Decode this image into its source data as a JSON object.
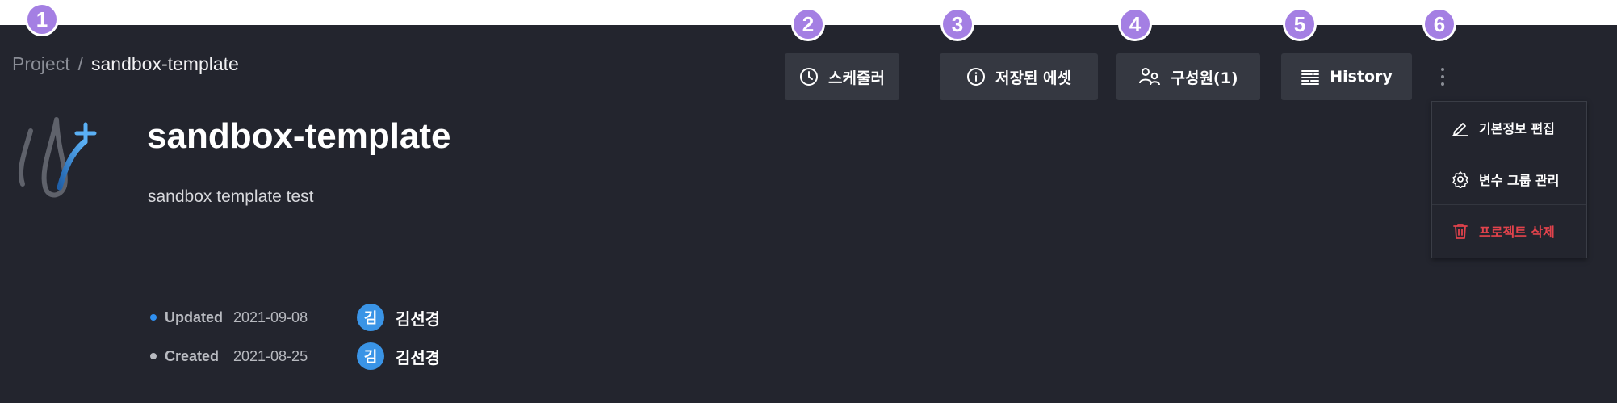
{
  "markers": [
    "1",
    "2",
    "3",
    "4",
    "5",
    "6"
  ],
  "breadcrumb": {
    "project": "Project",
    "separator": "/",
    "current": "sandbox-template"
  },
  "project": {
    "title": "sandbox-template",
    "description": "sandbox template test",
    "logo_icon": "droplet-plus-logo"
  },
  "meta": {
    "updated": {
      "label": "Updated",
      "date": "2021-09-08",
      "avatar": "김",
      "user": "김선경",
      "dot_color": "#2f8ff0"
    },
    "created": {
      "label": "Created",
      "date": "2021-08-25",
      "avatar": "김",
      "user": "김선경",
      "dot_color": "#b8bac0"
    }
  },
  "toolbar": {
    "scheduler": {
      "label": "스케줄러",
      "icon": "clock-icon"
    },
    "saved_assets": {
      "label": "저장된 에셋",
      "icon": "info-icon"
    },
    "members": {
      "label": "구성원(1)",
      "icon": "users-icon"
    },
    "history": {
      "label": "History",
      "icon": "list-icon"
    },
    "more": {
      "icon": "kebab-icon"
    }
  },
  "menu": {
    "items": [
      {
        "label": "기본정보 편집",
        "icon": "pencil-icon"
      },
      {
        "label": "변수 그룹 관리",
        "icon": "gear-icon"
      },
      {
        "label": "프로젝트 삭제",
        "icon": "trash-icon"
      }
    ]
  },
  "colors": {
    "background": "#23252e",
    "button": "#353841",
    "accent": "#3a94e6",
    "danger": "#e2434c",
    "marker": "#a47fe3"
  }
}
